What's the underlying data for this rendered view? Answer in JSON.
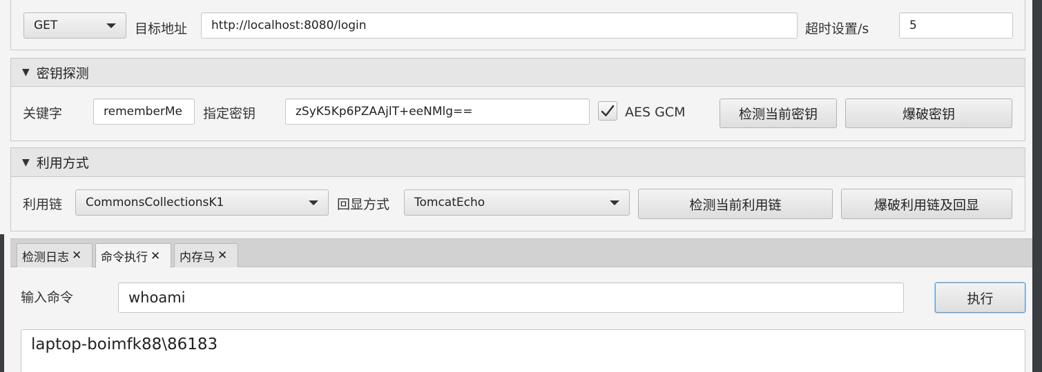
{
  "request": {
    "method": "GET",
    "target_label": "目标地址",
    "target_url": "http://localhost:8080/login",
    "timeout_label": "超时设置/s",
    "timeout_value": "5"
  },
  "key_section": {
    "title": "密钥探测",
    "keyword_label": "关键字",
    "keyword_value": "rememberMe",
    "key_label": "指定密钥",
    "key_value": "zSyK5Kp6PZAAjlT+eeNMlg==",
    "aes_gcm_label": "AES GCM",
    "aes_gcm_checked": true,
    "detect_key_button": "检测当前密钥",
    "brute_key_button": "爆破密钥"
  },
  "exploit_section": {
    "title": "利用方式",
    "chain_label": "利用链",
    "chain_value": "CommonsCollectionsK1",
    "echo_label": "回显方式",
    "echo_value": "TomcatEcho",
    "detect_chain_button": "检测当前利用链",
    "brute_chain_button": "爆破利用链及回显"
  },
  "tabs": [
    {
      "label": "检测日志",
      "active": false
    },
    {
      "label": "命令执行",
      "active": true
    },
    {
      "label": "内存马",
      "active": false
    }
  ],
  "tab_close_glyph": "✕",
  "command": {
    "label": "输入命令",
    "value": "whoami",
    "execute_button": "执行",
    "output": "laptop-boimfk88\\86183"
  },
  "icons": {
    "collapse": "triangle-down-icon",
    "dropdown": "chevron-down-icon",
    "check": "checkmark-icon",
    "close": "close-icon"
  }
}
